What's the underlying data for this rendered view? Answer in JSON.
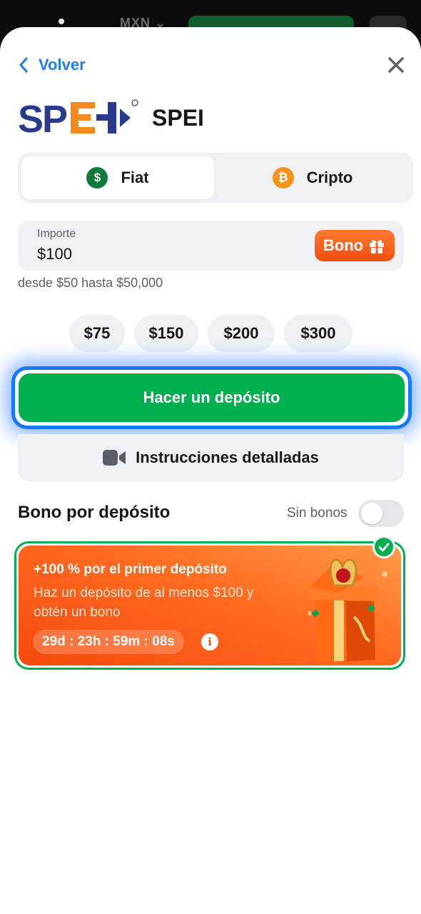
{
  "background": {
    "currency": "MXN ⌄"
  },
  "header": {
    "back_label": "Volver"
  },
  "method": {
    "logo_text": "SPEI",
    "name": "SPEI"
  },
  "tabs": [
    {
      "label": "Fiat",
      "icon": "dollar-coin-icon",
      "active": true
    },
    {
      "label": "Cripto",
      "icon": "bitcoin-coin-icon",
      "active": false
    }
  ],
  "amount": {
    "label": "Importe",
    "value": "$100",
    "bono_label": "Bono",
    "range_text": "desde $50 hasta $50,000"
  },
  "presets": [
    "$75",
    "$150",
    "$200",
    "$300"
  ],
  "actions": {
    "deposit_label": "Hacer un depósito",
    "instructions_label": "Instrucciones detalladas"
  },
  "bonus_section": {
    "title": "Bono por depósito",
    "toggle_label": "Sin bonos",
    "toggle_on": false
  },
  "bonus_card": {
    "headline": "+100 % por el primer depósito",
    "description": "Haz un depósito de al menos $100 y obtén un bono",
    "timer": "29d : 23h : 59m : 08s",
    "selected": true
  },
  "colors": {
    "accent_blue": "#1e7de6",
    "primary_green": "#00b04f",
    "bonus_orange": "#f04e10",
    "focus_blue": "#1677ff"
  }
}
